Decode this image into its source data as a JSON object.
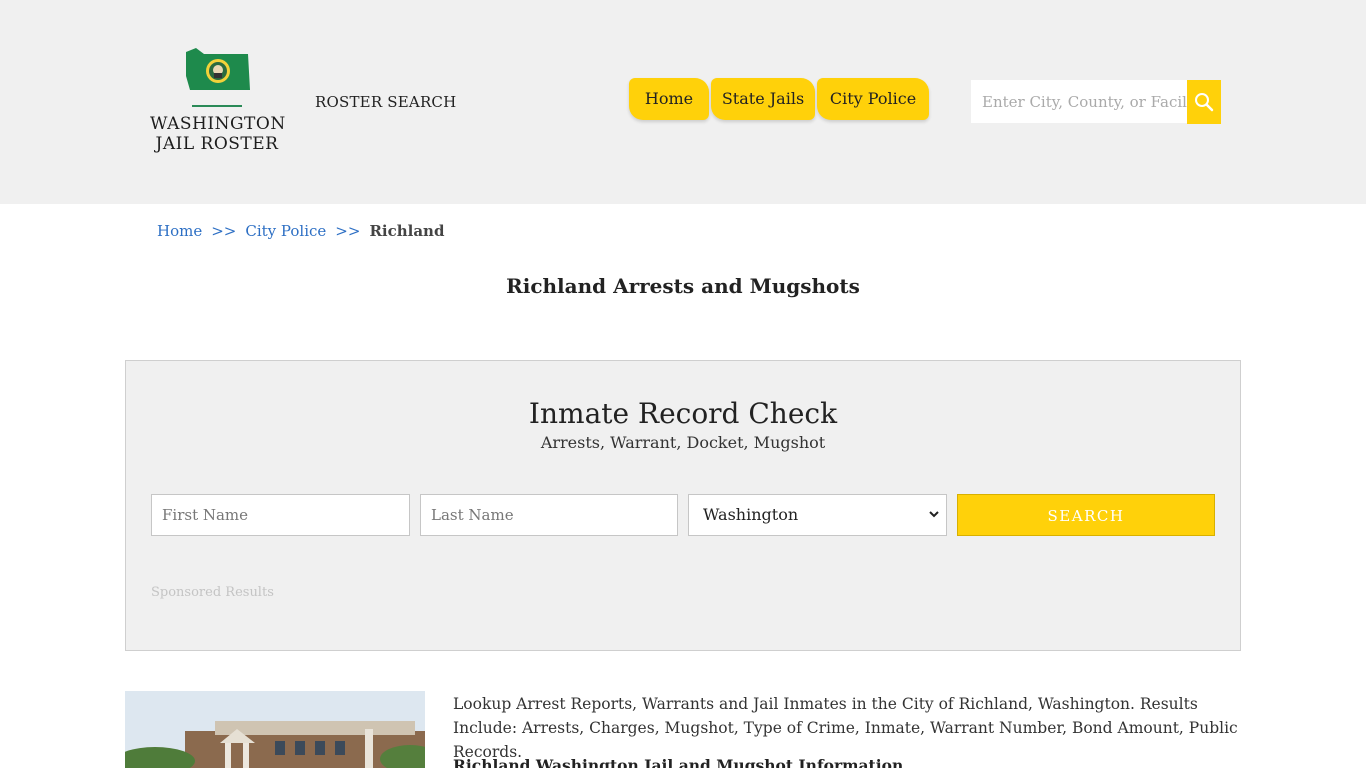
{
  "header": {
    "logo_line1": "WASHINGTON",
    "logo_line2": "JAIL ROSTER",
    "roster_search": "ROSTER SEARCH",
    "nav": [
      {
        "label": "Home"
      },
      {
        "label": "State Jails"
      },
      {
        "label": "City Police"
      }
    ],
    "search_placeholder": "Enter City, County, or Facility",
    "colors": {
      "accent": "#ffd10a",
      "header_bg": "#f0f0f0",
      "link": "#2d6fc4"
    }
  },
  "breadcrumb": {
    "home": "Home",
    "sep1": ">>",
    "city_police": "City Police",
    "sep2": ">>",
    "current": "Richland"
  },
  "page_title": "Richland Arrests and Mugshots",
  "record_check": {
    "title": "Inmate Record Check",
    "subtitle": "Arrests, Warrant, Docket, Mugshot",
    "first_name_placeholder": "First Name",
    "last_name_placeholder": "Last Name",
    "state_selected": "Washington",
    "search_label": "SEARCH",
    "sponsored": "Sponsored Results"
  },
  "content": {
    "description": "Lookup Arrest Reports, Warrants and Jail Inmates in the City of Richland, Washington. Results Include: Arrests, Charges, Mugshot, Type of Crime, Inmate, Warrant Number, Bond Amount, Public Records.",
    "subheading": "Richland Washington Jail and Mugshot Information"
  },
  "icons": {
    "search": "search-icon",
    "dropdown": "chevron-down-icon",
    "logo": "washington-state-flag-icon"
  }
}
